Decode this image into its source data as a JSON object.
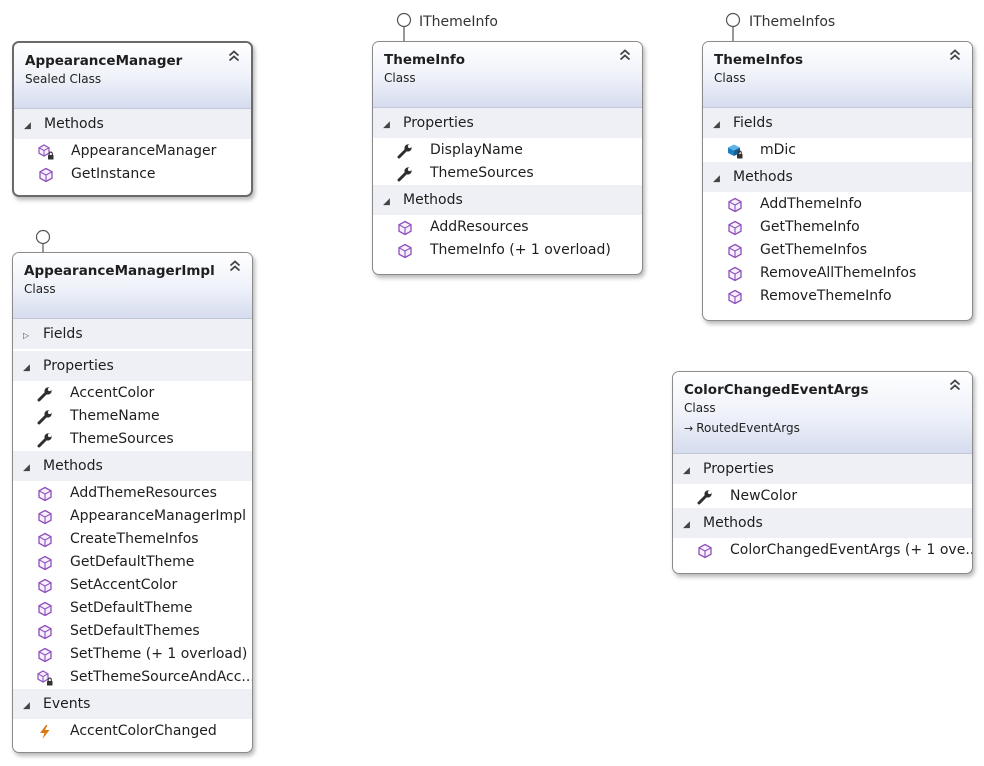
{
  "interfaces": {
    "itheme_info": "IThemeInfo",
    "itheme_infos": "IThemeInfos"
  },
  "appearance_manager": {
    "title": "AppearanceManager",
    "stereotype": "Sealed Class",
    "sections": {
      "methods": "Methods"
    },
    "methods": [
      "AppearanceManager",
      "GetInstance"
    ]
  },
  "appearance_manager_impl": {
    "title": "AppearanceManagerImpl",
    "stereotype": "Class",
    "sections": {
      "fields": "Fields",
      "properties": "Properties",
      "methods": "Methods",
      "events": "Events"
    },
    "properties": [
      "AccentColor",
      "ThemeName",
      "ThemeSources"
    ],
    "methods": [
      "AddThemeResources",
      "AppearanceManagerImpl",
      "CreateThemeInfos",
      "GetDefaultTheme",
      "SetAccentColor",
      "SetDefaultTheme",
      "SetDefaultThemes",
      "SetTheme (+ 1 overload)",
      "SetThemeSourceAndAcc..."
    ],
    "events": [
      "AccentColorChanged"
    ]
  },
  "theme_info": {
    "title": "ThemeInfo",
    "stereotype": "Class",
    "sections": {
      "properties": "Properties",
      "methods": "Methods"
    },
    "properties": [
      "DisplayName",
      "ThemeSources"
    ],
    "methods": [
      "AddResources",
      "ThemeInfo (+ 1 overload)"
    ]
  },
  "theme_infos": {
    "title": "ThemeInfos",
    "stereotype": "Class",
    "sections": {
      "fields": "Fields",
      "methods": "Methods"
    },
    "fields": [
      "mDic"
    ],
    "methods": [
      "AddThemeInfo",
      "GetThemeInfo",
      "GetThemeInfos",
      "RemoveAllThemeInfos",
      "RemoveThemeInfo"
    ]
  },
  "color_changed_event_args": {
    "title": "ColorChangedEventArgs",
    "stereotype": "Class",
    "base_class": "RoutedEventArgs",
    "sections": {
      "properties": "Properties",
      "methods": "Methods"
    },
    "properties": [
      "NewColor"
    ],
    "methods": [
      "ColorChangedEventArgs (+ 1 ove..."
    ]
  },
  "colors": {
    "header_gradient_end": "#d6dcef",
    "section_bg": "#eff0f5",
    "method_icon": "#8e4fbd",
    "field_icon": "#1c7fc4",
    "event_icon": "#d9780f",
    "border": "#8a8a8a"
  },
  "icons": {
    "method": "method-cube-icon",
    "private_method": "private-method-icon",
    "property": "wrench-icon",
    "field": "field-icon",
    "event": "lightning-icon",
    "collapse": "double-chevron-up-icon",
    "expand_triangle": "triangle-down-icon",
    "collapsed_triangle": "triangle-right-icon",
    "interface": "lollipop-interface-icon"
  }
}
